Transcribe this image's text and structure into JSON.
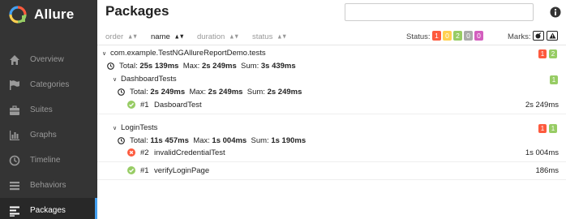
{
  "app": {
    "name": "Allure"
  },
  "sidebar": {
    "items": [
      {
        "label": "Overview",
        "icon": "home-icon",
        "active": false
      },
      {
        "label": "Categories",
        "icon": "flag-icon",
        "active": false
      },
      {
        "label": "Suites",
        "icon": "briefcase-icon",
        "active": false
      },
      {
        "label": "Graphs",
        "icon": "bar-chart-icon",
        "active": false
      },
      {
        "label": "Timeline",
        "icon": "clock-icon",
        "active": false
      },
      {
        "label": "Behaviors",
        "icon": "list-icon",
        "active": false
      },
      {
        "label": "Packages",
        "icon": "align-left-icon",
        "active": true
      }
    ]
  },
  "header": {
    "title": "Packages",
    "search_placeholder": ""
  },
  "toolbar": {
    "sort": [
      {
        "label": "order",
        "active": false
      },
      {
        "label": "name",
        "active": true
      },
      {
        "label": "duration",
        "active": false
      },
      {
        "label": "status",
        "active": false
      }
    ],
    "status_label": "Status:",
    "status_counts": [
      {
        "value": "1",
        "color": "#fd5a3e"
      },
      {
        "value": "0",
        "color": "#ffd050"
      },
      {
        "value": "2",
        "color": "#97cc64"
      },
      {
        "value": "0",
        "color": "#aaaaaa"
      },
      {
        "value": "0",
        "color": "#d35ebe"
      }
    ],
    "marks_label": "Marks:"
  },
  "tree": {
    "root": {
      "name": "com.example.TestNGAllureReportDemo.tests",
      "badges": [
        {
          "value": "1",
          "color": "#fd5a3e"
        },
        {
          "value": "2",
          "color": "#97cc64"
        }
      ],
      "stats": {
        "total_label": "Total:",
        "total": "25s 139ms",
        "max_label": "Max:",
        "max": "2s 249ms",
        "sum_label": "Sum:",
        "sum": "3s 439ms"
      }
    },
    "groups": [
      {
        "name": "DashboardTests",
        "badges": [
          {
            "value": "1",
            "color": "#97cc64"
          }
        ],
        "stats": {
          "total_label": "Total:",
          "total": "2s 249ms",
          "max_label": "Max:",
          "max": "2s 249ms",
          "sum_label": "Sum:",
          "sum": "2s 249ms"
        },
        "tests": [
          {
            "status": "passed",
            "num": "#1",
            "name": "DasboardTest",
            "duration": "2s 249ms"
          }
        ]
      },
      {
        "name": "LoginTests",
        "badges": [
          {
            "value": "1",
            "color": "#fd5a3e"
          },
          {
            "value": "1",
            "color": "#97cc64"
          }
        ],
        "stats": {
          "total_label": "Total:",
          "total": "11s 457ms",
          "max_label": "Max:",
          "max": "1s 004ms",
          "sum_label": "Sum:",
          "sum": "1s 190ms"
        },
        "tests": [
          {
            "status": "failed",
            "num": "#2",
            "name": "invalidCredentialTest",
            "duration": "1s 004ms"
          },
          {
            "status": "passed",
            "num": "#1",
            "name": "verifyLoginPage",
            "duration": "186ms"
          }
        ]
      }
    ]
  }
}
